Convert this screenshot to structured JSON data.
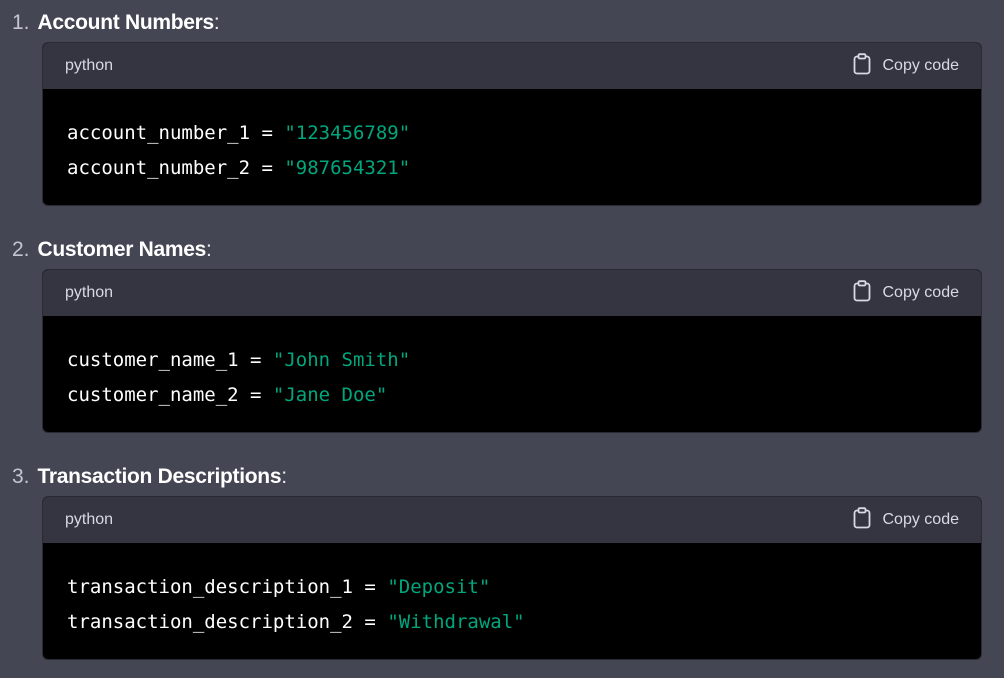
{
  "sections": [
    {
      "number": "1.",
      "title": "Account Numbers",
      "colon": ":",
      "lang": "python",
      "copy_label": "Copy code",
      "lines": [
        {
          "var": "account_number_1",
          "op": " = ",
          "str": "\"123456789\""
        },
        {
          "var": "account_number_2",
          "op": " = ",
          "str": "\"987654321\""
        }
      ]
    },
    {
      "number": "2.",
      "title": "Customer Names",
      "colon": ":",
      "lang": "python",
      "copy_label": "Copy code",
      "lines": [
        {
          "var": "customer_name_1",
          "op": " = ",
          "str": "\"John Smith\""
        },
        {
          "var": "customer_name_2",
          "op": " = ",
          "str": "\"Jane Doe\""
        }
      ]
    },
    {
      "number": "3.",
      "title": "Transaction Descriptions",
      "colon": ":",
      "lang": "python",
      "copy_label": "Copy code",
      "lines": [
        {
          "var": "transaction_description_1",
          "op": " = ",
          "str": "\"Deposit\""
        },
        {
          "var": "transaction_description_2",
          "op": " = ",
          "str": "\"Withdrawal\""
        }
      ]
    }
  ],
  "colors": {
    "background": "#444654",
    "code_background": "#000000",
    "header_background": "#343541",
    "string": "#00a67d"
  },
  "icons": {
    "copy": "clipboard-icon"
  }
}
